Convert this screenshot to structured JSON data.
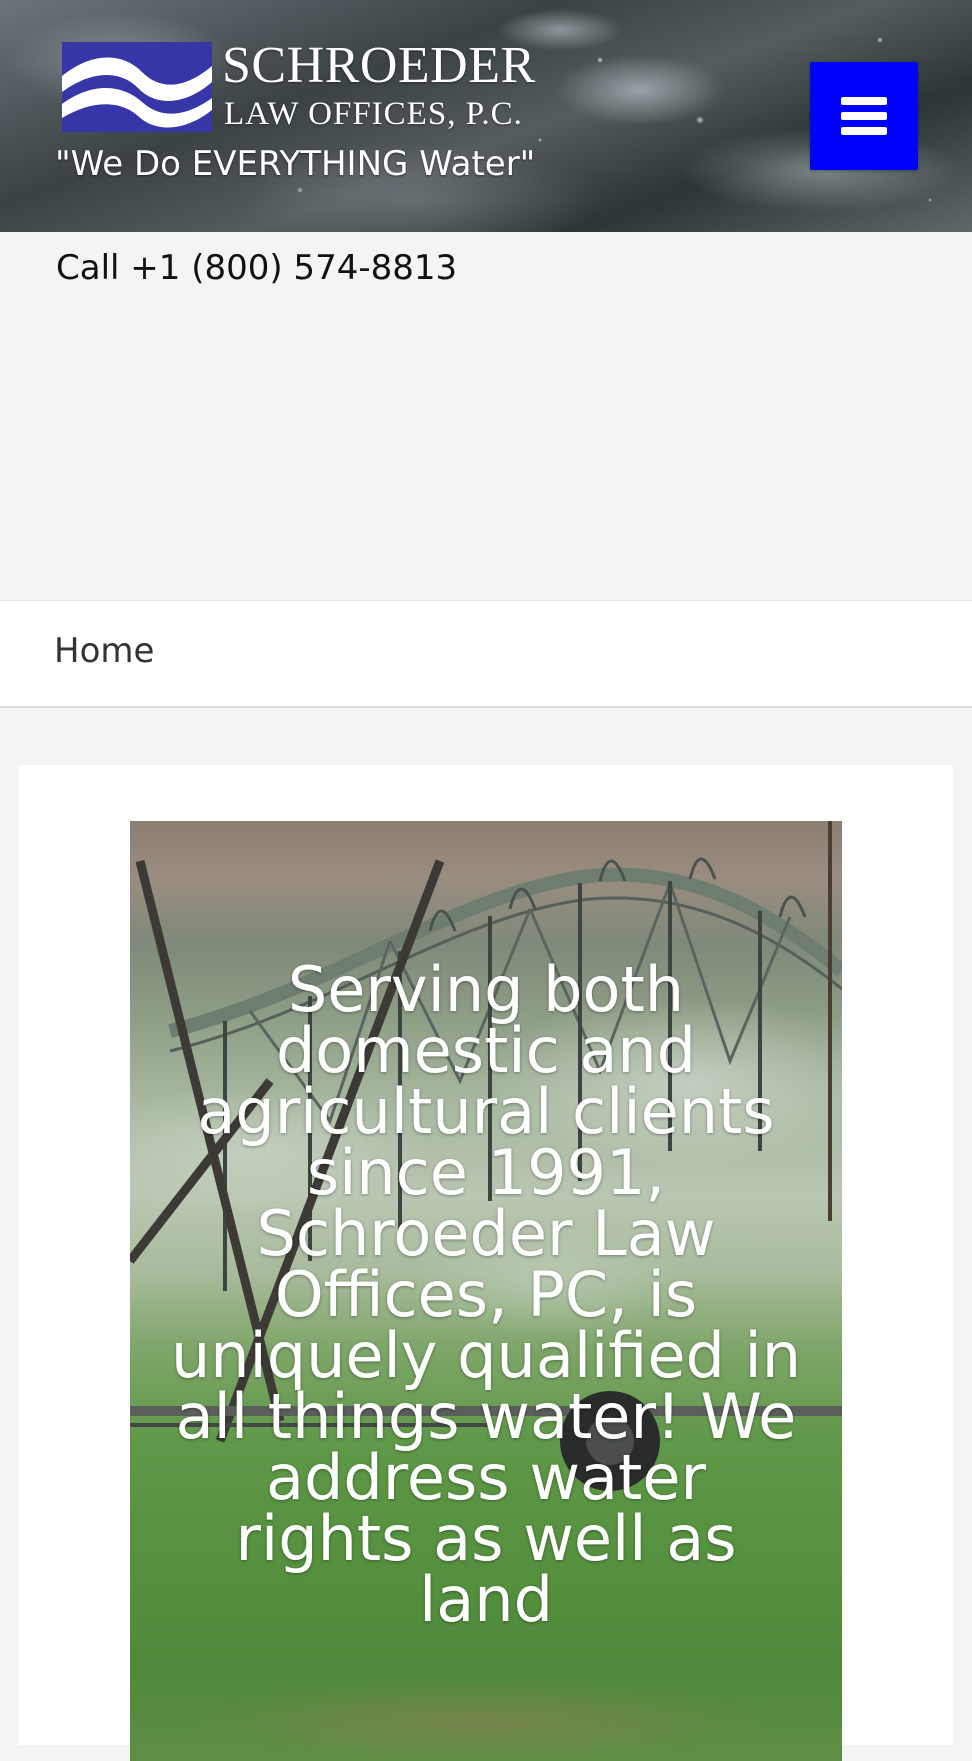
{
  "header": {
    "logo": {
      "name_line": "SCHROEDER",
      "sub_line": "LAW OFFICES, P.C."
    },
    "tagline": "\"We Do EVERYTHING Water\"",
    "menu_icon": "hamburger-menu-icon",
    "menu_color": "#0000ff"
  },
  "contact": {
    "call_label": "Call +1 (800) 574-8813"
  },
  "breadcrumb": {
    "home": "Home"
  },
  "hero": {
    "text": "Serving both domestic and agricultural clients since 1991, Schroeder Law Offices, PC, is uniquely qualified in all things water! We address water rights as well as land"
  }
}
